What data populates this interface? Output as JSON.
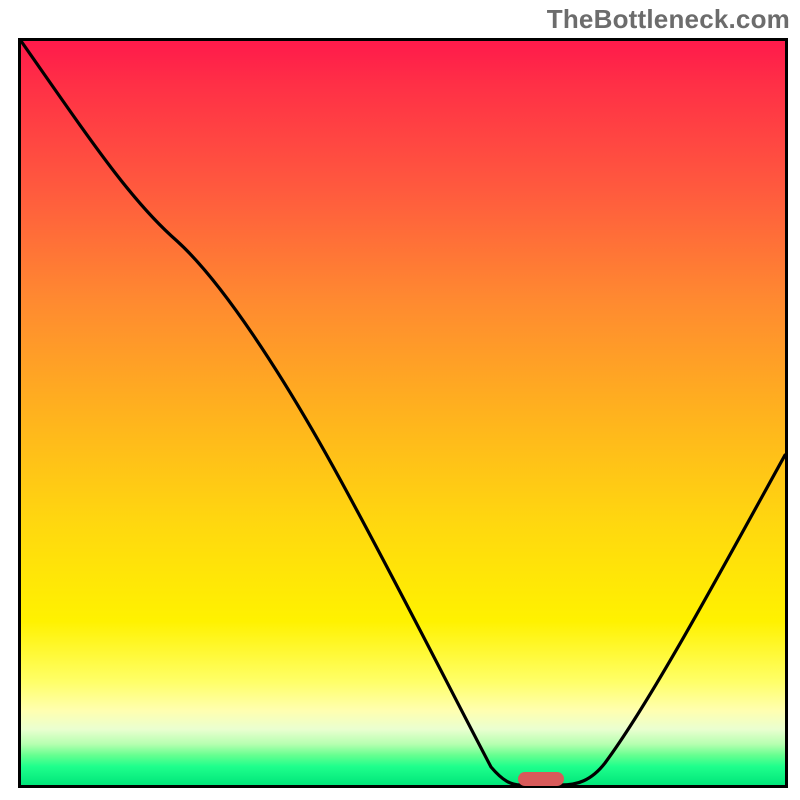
{
  "watermark": "TheBottleneck.com",
  "colors": {
    "gradient_top": "#ff1a4b",
    "gradient_bottom": "#00e67a",
    "curve_stroke": "#000000",
    "marker_fill": "#d85a5a",
    "watermark_text": "#6c6c6c"
  },
  "chart_data": {
    "type": "line",
    "title": "",
    "xlabel": "",
    "ylabel": "",
    "xlim": [
      0,
      100
    ],
    "ylim": [
      0,
      100
    ],
    "grid": false,
    "x": [
      0,
      20,
      60,
      65,
      70,
      76,
      100
    ],
    "values": [
      100,
      73,
      6,
      0,
      0,
      2,
      45
    ],
    "marker": {
      "x_center": 68,
      "y": 0,
      "width_pct": 6
    },
    "annotations": []
  }
}
